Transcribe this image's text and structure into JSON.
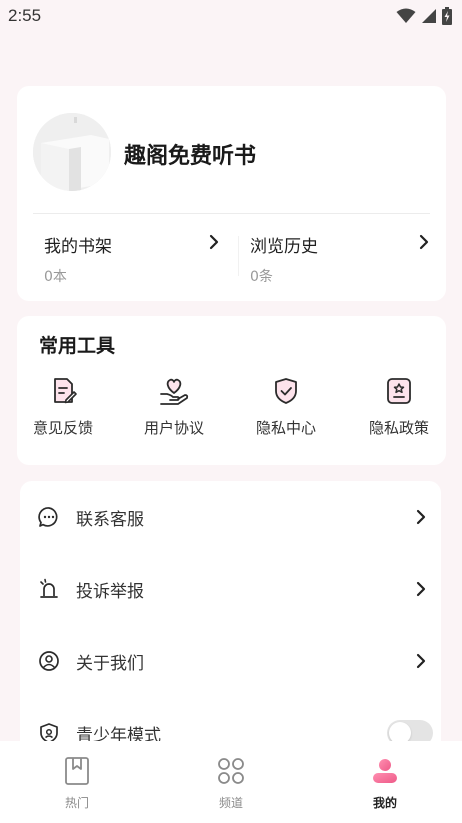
{
  "status_bar": {
    "time": "2:55"
  },
  "profile": {
    "name": "趣阁免费听书"
  },
  "stats": [
    {
      "title": "我的书架",
      "count": "0本"
    },
    {
      "title": "浏览历史",
      "count": "0条"
    }
  ],
  "tools": {
    "title": "常用工具",
    "items": [
      {
        "label": "意见反馈",
        "icon": "feedback-icon"
      },
      {
        "label": "用户协议",
        "icon": "heart-hand-icon"
      },
      {
        "label": "隐私中心",
        "icon": "shield-check-icon"
      },
      {
        "label": "隐私政策",
        "icon": "policy-icon"
      }
    ]
  },
  "menu": {
    "items": [
      {
        "label": "联系客服",
        "icon": "chat-bubble-icon"
      },
      {
        "label": "投诉举报",
        "icon": "alarm-icon"
      },
      {
        "label": "关于我们",
        "icon": "user-circle-icon"
      },
      {
        "label": "青少年模式",
        "icon": "youth-shield-icon",
        "toggle": false
      }
    ]
  },
  "bottom_nav": {
    "items": [
      {
        "label": "热门",
        "icon": "bookmark-book-icon",
        "active": false
      },
      {
        "label": "频道",
        "icon": "grid-channels-icon",
        "active": false
      },
      {
        "label": "我的",
        "icon": "profile-person-icon",
        "active": true
      }
    ]
  },
  "colors": {
    "accent": "#f06b94",
    "background": "#fbf4f6"
  }
}
